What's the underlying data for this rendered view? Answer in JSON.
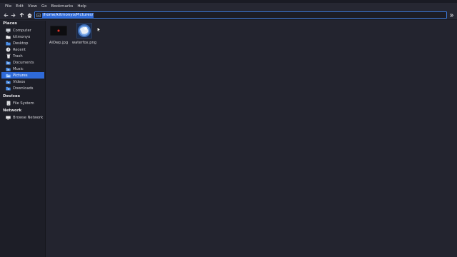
{
  "menu": [
    "File",
    "Edit",
    "View",
    "Go",
    "Bookmarks",
    "Help"
  ],
  "path": "/home/kitmonyo/Pictures/",
  "places": {
    "heading": "Places",
    "items": [
      {
        "label": "Computer",
        "icon": "computer-icon"
      },
      {
        "label": "kitmonyo",
        "icon": "home-folder-icon"
      },
      {
        "label": "Desktop",
        "icon": "desktop-icon"
      },
      {
        "label": "Recent",
        "icon": "recent-icon"
      },
      {
        "label": "Trash",
        "icon": "trash-icon"
      },
      {
        "label": "Documents",
        "icon": "documents-folder-icon"
      },
      {
        "label": "Music",
        "icon": "music-folder-icon"
      },
      {
        "label": "Pictures",
        "icon": "pictures-folder-icon",
        "selected": true
      },
      {
        "label": "Videos",
        "icon": "videos-folder-icon"
      },
      {
        "label": "Downloads",
        "icon": "downloads-folder-icon"
      }
    ]
  },
  "devices": {
    "heading": "Devices",
    "items": [
      {
        "label": "File System",
        "icon": "drive-icon"
      }
    ]
  },
  "network": {
    "heading": "Network",
    "items": [
      {
        "label": "Browse Network",
        "icon": "network-icon"
      }
    ]
  },
  "files": [
    {
      "name": "AiOwp.jpg",
      "icon": "image-thumbnail-dark"
    },
    {
      "name": "waterfox.png",
      "icon": "image-thumbnail-waterfox"
    }
  ],
  "colors": {
    "accent": "#2f6ad8",
    "background": "#23242f",
    "sidebar": "#1d1e27"
  }
}
